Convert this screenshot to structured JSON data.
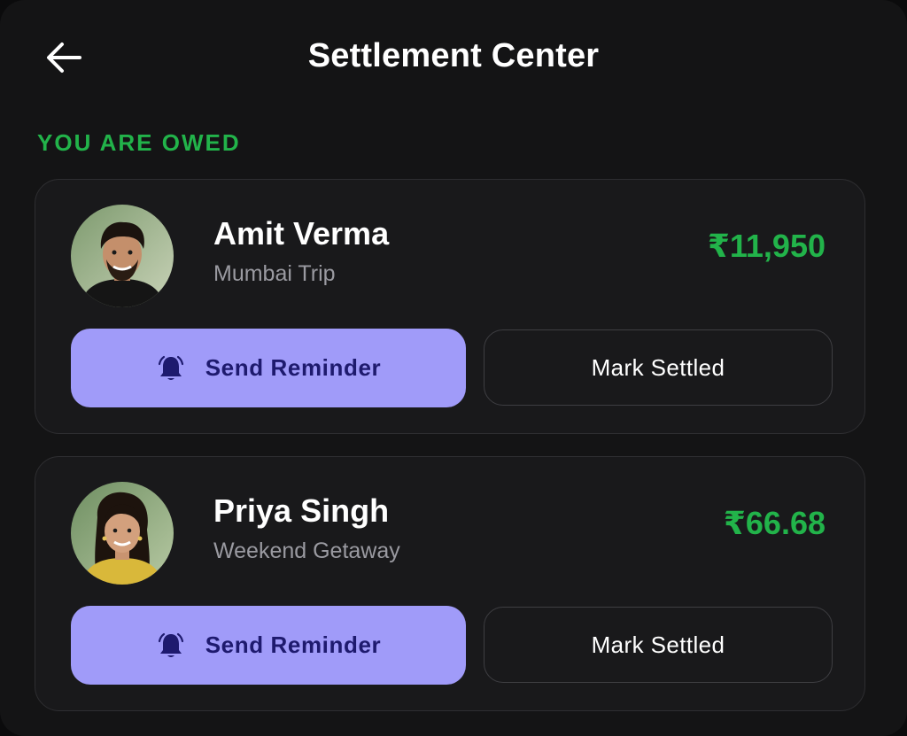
{
  "header": {
    "title": "Settlement Center",
    "back_icon": "arrow-left-icon"
  },
  "section": {
    "label": "YOU ARE OWED"
  },
  "colors": {
    "accent_green": "#22b34a",
    "button_purple": "#a09bf9",
    "button_text": "#1e1a6e",
    "background": "#141415"
  },
  "debtors": [
    {
      "name": "Amit Verma",
      "trip": "Mumbai Trip",
      "amount": "₹11,950",
      "remind_label": "Send Reminder",
      "settle_label": "Mark Settled",
      "avatar_icon": "avatar-photo"
    },
    {
      "name": "Priya Singh",
      "trip": "Weekend Getaway",
      "amount": "₹66.68",
      "remind_label": "Send Reminder",
      "settle_label": "Mark Settled",
      "avatar_icon": "avatar-photo"
    }
  ]
}
